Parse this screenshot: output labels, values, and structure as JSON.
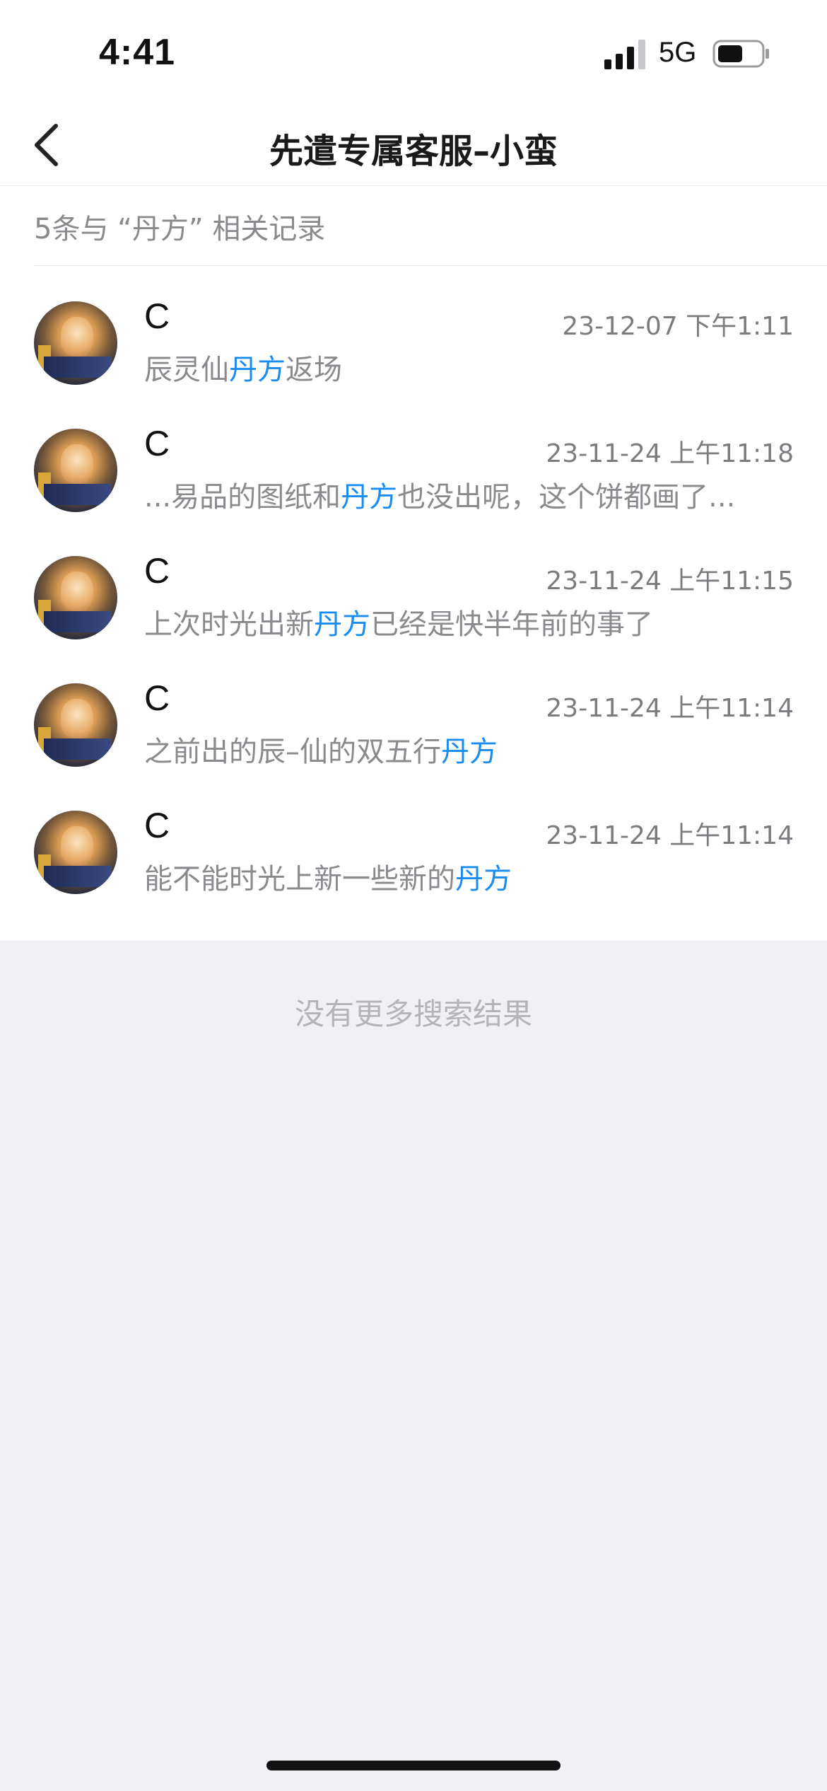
{
  "status_bar": {
    "time": "4:41",
    "network": "5G"
  },
  "nav": {
    "back_icon": "chevron-left-icon",
    "title": "先遣专属客服–小蛮"
  },
  "summary": "5条与 “丹方” 相关记录",
  "colors": {
    "highlight": "#1a8cf0",
    "secondary_text": "#8a8a8e",
    "page_background": "#f0f0f5"
  },
  "results": [
    {
      "sender": "C",
      "time": "23-12-07 下午1:11",
      "before": "辰灵仙",
      "keyword": "丹方",
      "after": "返场"
    },
    {
      "sender": "C",
      "time": "23-11-24 上午11:18",
      "before": "...易品的图纸和",
      "keyword": "丹方",
      "after": "也没出呢，这个饼都画了..."
    },
    {
      "sender": "C",
      "time": "23-11-24 上午11:15",
      "before": "上次时光出新",
      "keyword": "丹方",
      "after": "已经是快半年前的事了"
    },
    {
      "sender": "C",
      "time": "23-11-24 上午11:14",
      "before": "之前出的辰–仙的双五行",
      "keyword": "丹方",
      "after": ""
    },
    {
      "sender": "C",
      "time": "23-11-24 上午11:14",
      "before": "能不能时光上新一些新的",
      "keyword": "丹方",
      "after": ""
    }
  ],
  "footer": {
    "no_more_text": "没有更多搜索结果"
  }
}
